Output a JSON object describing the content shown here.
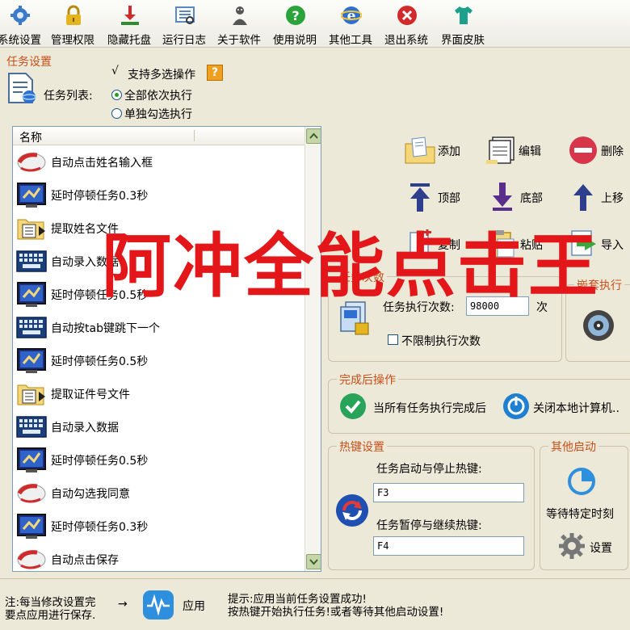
{
  "toolbar": {
    "items": [
      {
        "label": "系统设置",
        "icon": "gear-icon",
        "color": "#3b79c9"
      },
      {
        "label": "管理权限",
        "icon": "lock-icon",
        "color": "#e5b521"
      },
      {
        "label": "隐藏托盘",
        "icon": "download-tray-icon",
        "color": "#2e8b2e"
      },
      {
        "label": "运行日志",
        "icon": "log-icon",
        "color": "#5a87c6"
      },
      {
        "label": "关于软件",
        "icon": "person-icon",
        "color": "#555555"
      },
      {
        "label": "使用说明",
        "icon": "help-icon",
        "color": "#29a33a"
      },
      {
        "label": "其他工具",
        "icon": "globe-icon",
        "color": "#2f6fd0"
      },
      {
        "label": "退出系统",
        "icon": "exit-icon",
        "color": "#d12a2a"
      },
      {
        "label": "界面皮肤",
        "icon": "shirt-icon",
        "color": "#1d9f8b"
      }
    ]
  },
  "task_settings": {
    "title": "任务设置",
    "list_label": "任务列表:",
    "multi_select_label": "支持多选操作",
    "option_all": "全部依次执行",
    "option_single": "单独勾选执行",
    "selected_option": "全部依次执行"
  },
  "task_list": {
    "column_header": "名称",
    "items": [
      {
        "label": "自动点击姓名输入框",
        "icon": "mouse-icon"
      },
      {
        "label": "延时停顿任务0.3秒",
        "icon": "monitor-icon"
      },
      {
        "label": "提取姓名文件",
        "icon": "folder-list-icon"
      },
      {
        "label": "自动录入数据",
        "icon": "keyboard-icon"
      },
      {
        "label": "延时停顿任务0.5秒",
        "icon": "monitor-icon"
      },
      {
        "label": "自动按tab键跳下一个",
        "icon": "keyboard-icon"
      },
      {
        "label": "延时停顿任务0.5秒",
        "icon": "monitor-icon"
      },
      {
        "label": "提取证件号文件",
        "icon": "folder-list-icon"
      },
      {
        "label": "自动录入数据",
        "icon": "keyboard-icon"
      },
      {
        "label": "延时停顿任务0.5秒",
        "icon": "monitor-icon"
      },
      {
        "label": "自动勾选我同意",
        "icon": "mouse-icon"
      },
      {
        "label": "延时停顿任务0.3秒",
        "icon": "monitor-icon"
      },
      {
        "label": "自动点击保存",
        "icon": "mouse-icon"
      }
    ]
  },
  "actions": {
    "add": "添加",
    "edit": "编辑",
    "delete": "删除",
    "top": "顶部",
    "bottom": "底部",
    "move_up": "上移",
    "copy": "复制",
    "paste": "粘贴",
    "import": "导入"
  },
  "execution": {
    "title": "任务次数",
    "count_label": "任务执行次数:",
    "count_value": "98000",
    "count_unit": "次",
    "unlimited_label": "不限制执行次数",
    "nested_title": "嵌套执行"
  },
  "after_complete": {
    "title": "完成后操作",
    "condition": "当所有任务执行完成后",
    "action": "关闭本地计算机.."
  },
  "hotkeys": {
    "title": "热键设置",
    "start_stop_label": "任务启动与停止热键:",
    "start_stop_value": "F3",
    "pause_resume_label": "任务暂停与继续热键:",
    "pause_resume_value": "F4"
  },
  "other_start": {
    "title": "其他启动",
    "wait_label": "等待特定时刻",
    "settings_label": "设置"
  },
  "footer": {
    "note_line1": "注:每当修改设置完",
    "note_line2": "要点应用进行保存.",
    "arrow": "→",
    "apply_label": "应用",
    "hint_line1": "提示:应用当前任务设置成功!",
    "hint_line2": "按热键开始执行任务!或者等待其他启动设置!"
  },
  "watermark": "阿冲全能点击王",
  "colors": {
    "accent_title": "#c7501a",
    "watermark": "#e3171a",
    "background": "#ECE9D8"
  }
}
